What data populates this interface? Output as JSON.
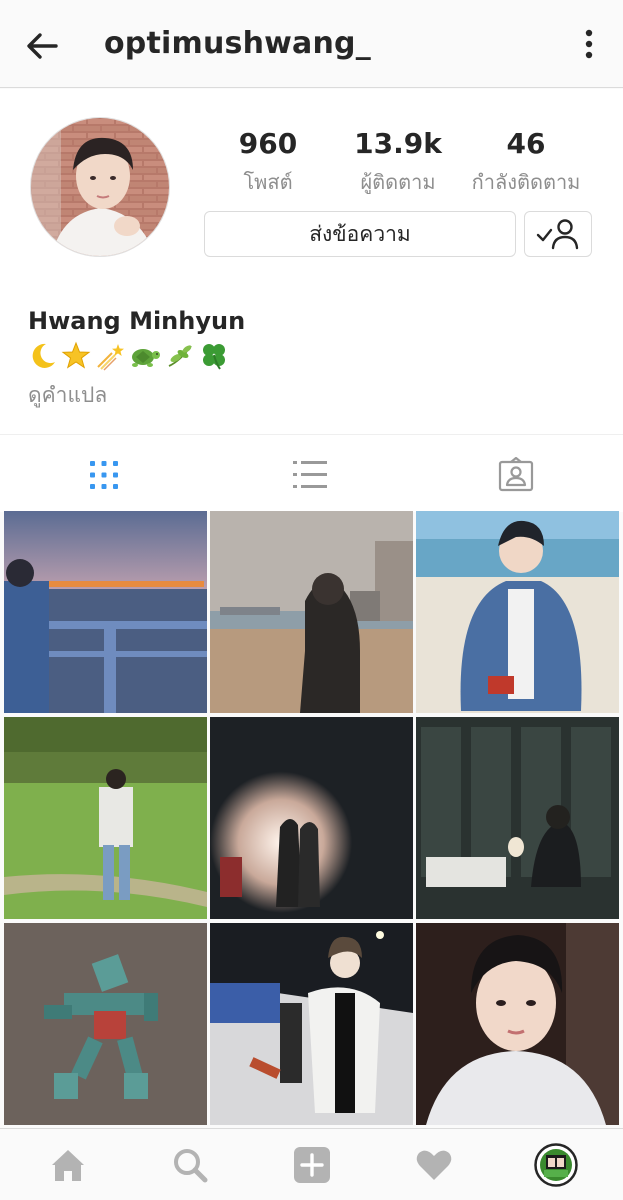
{
  "header": {
    "username": "optimushwang_"
  },
  "profile": {
    "stats": [
      {
        "value": "960",
        "label": "โพสต์"
      },
      {
        "value": "13.9k",
        "label": "ผู้ติดตาม"
      },
      {
        "value": "46",
        "label": "กำลังติดตาม"
      }
    ],
    "message_button": "ส่งข้อความ",
    "full_name": "Hwang Minhyun",
    "bio_icons": [
      "crescent-moon",
      "star",
      "shooting-star",
      "turtle",
      "herb",
      "four-leaf-clover"
    ],
    "translate_link": "ดูคำแปล"
  },
  "tabs": [
    "grid-view",
    "list-view",
    "tagged-photos"
  ],
  "active_tab": "grid-view",
  "colors": {
    "accent": "#3897f0",
    "icon_gray": "#999999",
    "text_muted": "#8e8e8e"
  },
  "posts": [
    {
      "subject": "sunset-sea-railing"
    },
    {
      "subject": "beach-city-photographer"
    },
    {
      "subject": "denim-jacket-beach"
    },
    {
      "subject": "grass-field"
    },
    {
      "subject": "dark-room-silhouettes"
    },
    {
      "subject": "night-window-cafe"
    },
    {
      "subject": "robot-keychain"
    },
    {
      "subject": "ski-slope-night"
    },
    {
      "subject": "selfie-closeup"
    }
  ],
  "bottom_nav": [
    "home",
    "search",
    "add-post",
    "activity",
    "profile"
  ]
}
